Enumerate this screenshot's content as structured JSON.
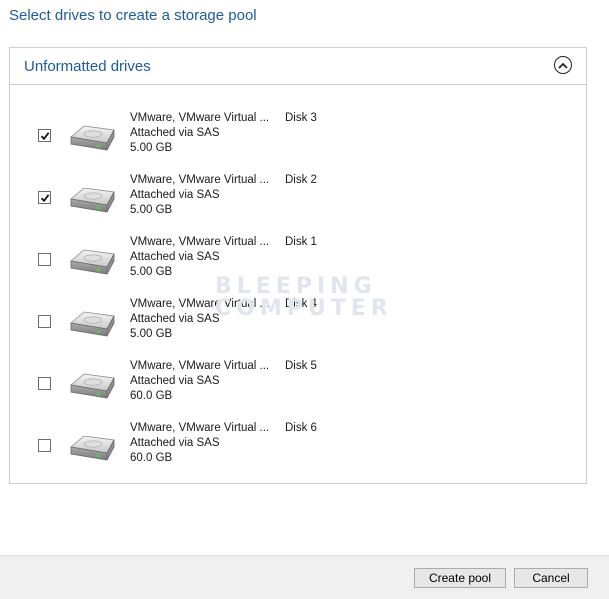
{
  "header": {
    "title": "Select drives to create a storage pool"
  },
  "panel": {
    "title": "Unformatted drives"
  },
  "watermark": {
    "line1": "BLEEPING",
    "line2": "COMPUTER"
  },
  "drives": [
    {
      "name": "VMware, VMware Virtual ...",
      "connection": "Attached via SAS",
      "size": "5.00 GB",
      "disk": "Disk 3",
      "checked": true
    },
    {
      "name": "VMware, VMware Virtual ...",
      "connection": "Attached via SAS",
      "size": "5.00 GB",
      "disk": "Disk 2",
      "checked": true
    },
    {
      "name": "VMware, VMware Virtual ...",
      "connection": "Attached via SAS",
      "size": "5.00 GB",
      "disk": "Disk 1",
      "checked": false
    },
    {
      "name": "VMware, VMware Virtual ...",
      "connection": "Attached via SAS",
      "size": "5.00 GB",
      "disk": "Disk 4",
      "checked": false
    },
    {
      "name": "VMware, VMware Virtual ...",
      "connection": "Attached via SAS",
      "size": "60.0 GB",
      "disk": "Disk 5",
      "checked": false
    },
    {
      "name": "VMware, VMware Virtual ...",
      "connection": "Attached via SAS",
      "size": "60.0 GB",
      "disk": "Disk 6",
      "checked": false
    }
  ],
  "footer": {
    "create_label": "Create pool",
    "cancel_label": "Cancel"
  }
}
